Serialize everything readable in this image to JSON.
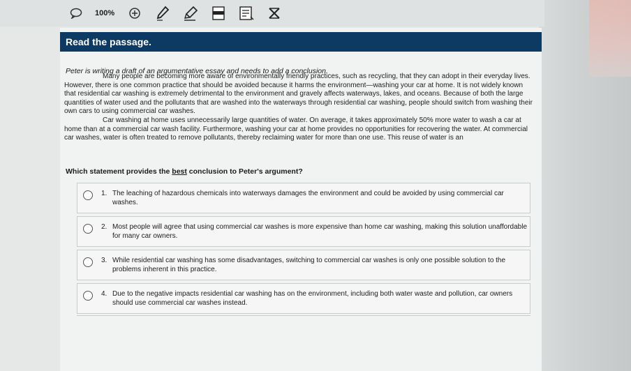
{
  "toolbar": {
    "zoom_label": "100%",
    "tools": [
      {
        "icon": "comment-icon"
      },
      {
        "icon": "zoom-in-icon"
      },
      {
        "icon": "pen-icon"
      },
      {
        "icon": "highlighter-icon"
      },
      {
        "icon": "line-reader-icon"
      },
      {
        "icon": "notepad-icon"
      },
      {
        "icon": "eliminate-choice-icon"
      }
    ]
  },
  "header": {
    "title": "Read the passage."
  },
  "instruction": "Peter is writing a draft of an argumentative essay and needs to add a conclusion.",
  "passage": {
    "paragraphs": [
      "Many people are becoming more aware of environmentally friendly practices, such as recycling, that they can adopt in their everyday lives. However, there is one common practice that should be avoided because it harms the environment—washing your car at home. It is not widely known that residential car washing is extremely detrimental to the environment and gravely affects waterways, lakes, and oceans. Because of both the large quantities of water used and the pollutants that are washed into the waterways through residential car washing, people should switch from washing their own cars to using commercial car washes.",
      "Car washing at home uses unnecessarily large quantities of water. On average, it takes approximately 50% more water to wash a car at home than at a commercial car wash facility. Furthermore, washing your car at home provides no opportunities for recovering the water. At commercial car washes, water is often treated to remove pollutants, thereby reclaiming water for more than one use. This reuse of water is an"
    ]
  },
  "question": {
    "before": "Which statement provides the ",
    "emphasis": "best",
    "after": " conclusion to Peter's argument?"
  },
  "choices": [
    {
      "number": "1.",
      "text": "The leaching of hazardous chemicals into waterways damages the environment and could be avoided by using commercial car washes."
    },
    {
      "number": "2.",
      "text": "Most people will agree that using commercial car washes is more expensive than home car washing, making this solution unaffordable for many car owners."
    },
    {
      "number": "3.",
      "text": "While residential car washing has some disadvantages, switching to commercial car washes is only one possible solution to the problems inherent in this practice."
    },
    {
      "number": "4.",
      "text": "Due to the negative impacts residential car washing has on the environment, including both water waste and pollution, car owners should use commercial car washes instead."
    }
  ]
}
